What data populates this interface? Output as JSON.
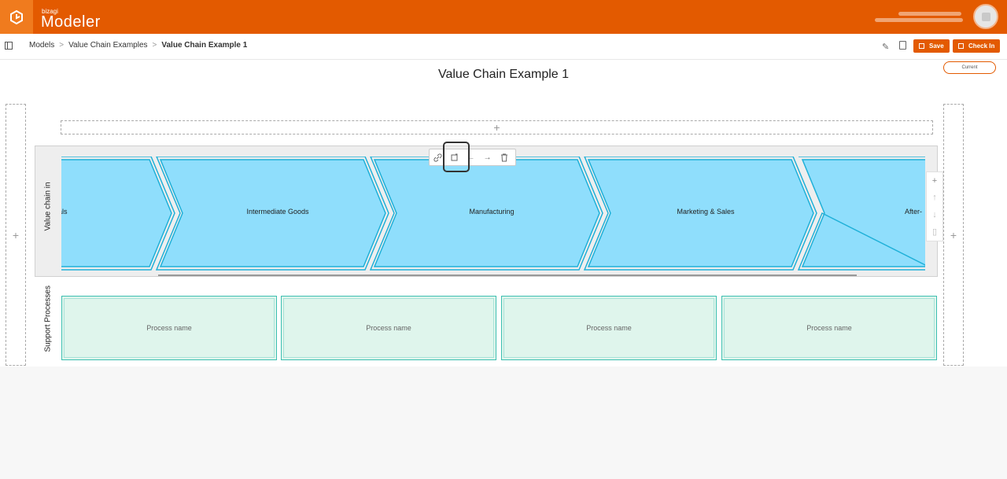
{
  "header": {
    "brand_small": "bizagi",
    "brand_name": "Modeler",
    "accent_color": "#e35a00"
  },
  "breadcrumb": {
    "items": [
      "Models",
      "Value Chain Examples",
      "Value Chain Example 1"
    ],
    "separator": ">"
  },
  "actions": {
    "save_label": "Save",
    "checkin_label": "Check In"
  },
  "canvas": {
    "title": "Value Chain Example 1",
    "version_label": "Current",
    "add_symbol": "+"
  },
  "value_chain": {
    "lane_label": "Value chain in",
    "chevrons": [
      "als",
      "Intermediate Goods",
      "Manufacturing",
      "Marketing & Sales",
      "After-"
    ]
  },
  "support": {
    "lane_label": "Support Processes",
    "processes": [
      "Process name",
      "Process name",
      "Process name",
      "Process name"
    ]
  },
  "colors": {
    "chevron_fill": "#8fdefc",
    "chevron_border": "#1fb0d8",
    "process_fill": "#dff5ec",
    "process_border": "#3cbfb0"
  }
}
